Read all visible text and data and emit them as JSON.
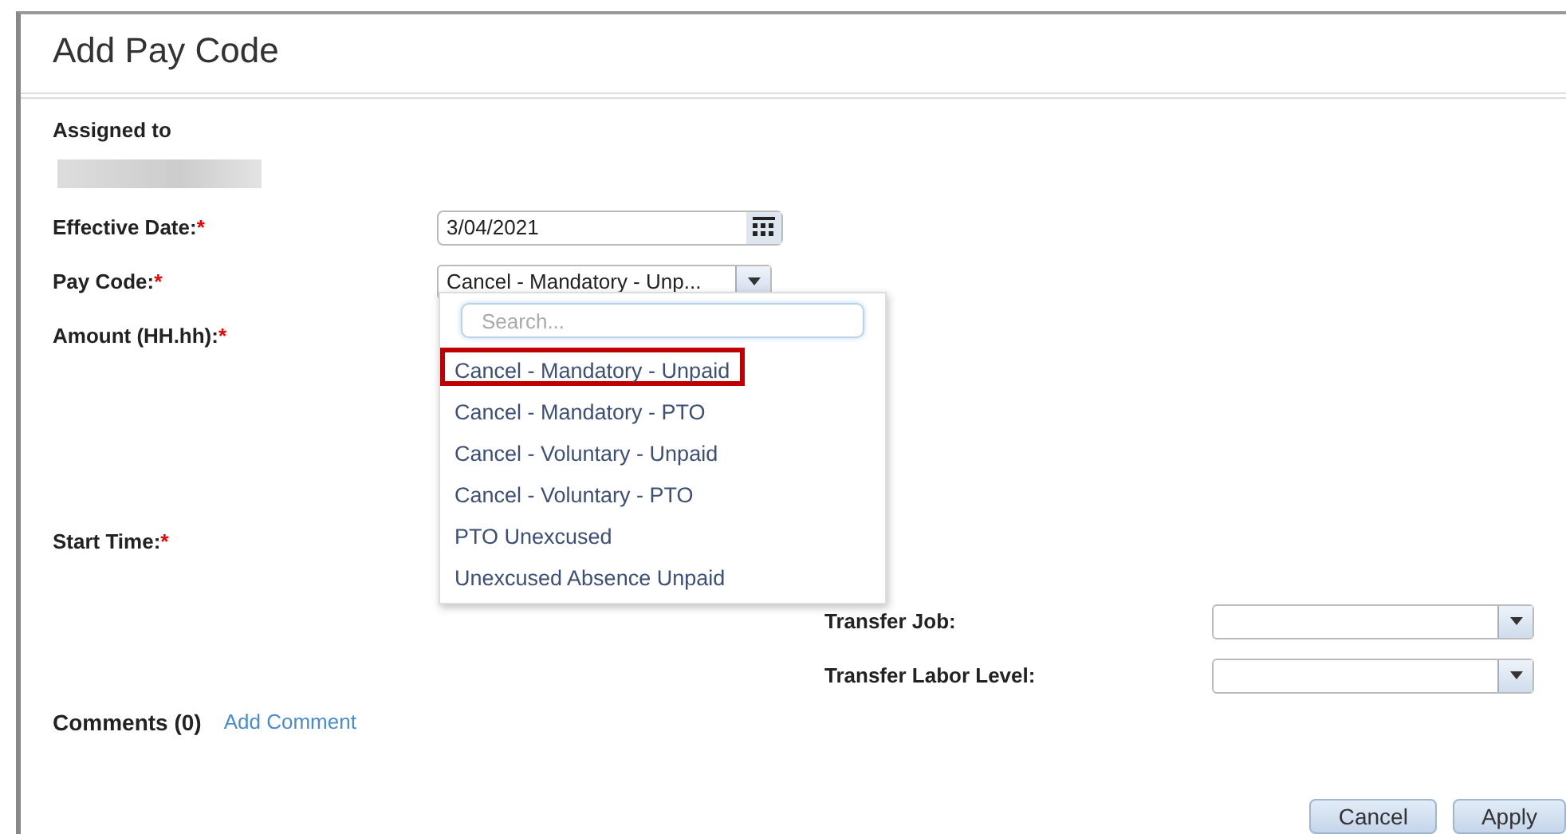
{
  "dialog": {
    "title": "Add Pay Code"
  },
  "assigned_to": {
    "label": "Assigned to"
  },
  "fields": [
    {
      "label": "Effective Date:",
      "required_mark": "*",
      "kind": "date",
      "value": "3/04/2021"
    },
    {
      "label": "Pay Code:",
      "required_mark": "*",
      "kind": "select",
      "value": "Cancel - Mandatory - Unp..."
    },
    {
      "label": "Amount (HH.hh):",
      "required_mark": "*",
      "kind": "none"
    },
    {
      "label": "Start Time:",
      "required_mark": "*",
      "kind": "none"
    }
  ],
  "dropdown": {
    "search_placeholder": "Search...",
    "options": [
      {
        "label": "Cancel - Mandatory - Unpaid",
        "selected": true
      },
      {
        "label": "Cancel - Mandatory - PTO",
        "selected": false
      },
      {
        "label": "Cancel - Voluntary - Unpaid",
        "selected": false
      },
      {
        "label": "Cancel - Voluntary - PTO",
        "selected": false
      },
      {
        "label": "PTO Unexcused",
        "selected": false
      },
      {
        "label": "Unexcused Absence Unpaid",
        "selected": false
      }
    ]
  },
  "transfer_fields": [
    {
      "label": "Transfer Job:"
    },
    {
      "label": "Transfer Labor Level:"
    }
  ],
  "comments": {
    "label": "Comments (0)",
    "link": "Add Comment"
  },
  "buttons": [
    "Cancel",
    "Apply"
  ]
}
